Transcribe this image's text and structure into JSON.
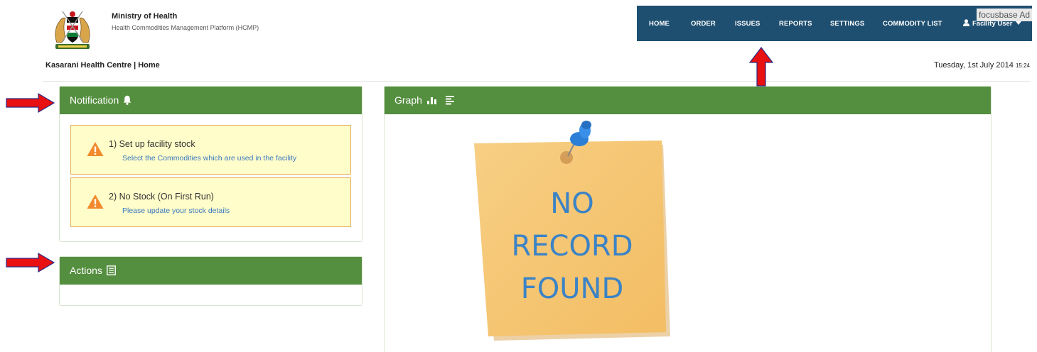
{
  "header": {
    "ministry_title": "Ministry of Health",
    "ministry_subtitle": "Health Commodities Management Platform (HCMP)"
  },
  "nav": {
    "items": [
      {
        "label": "HOME"
      },
      {
        "label": "ORDER"
      },
      {
        "label": "ISSUES"
      },
      {
        "label": "REPORTS"
      },
      {
        "label": "SETTINGS"
      },
      {
        "label": "COMMODITY LIST"
      }
    ],
    "user_label": "Facility User",
    "ad_label": "focusbase Ad"
  },
  "page": {
    "breadcrumb": "Kasarani Health Centre | Home",
    "date": "Tuesday, 1st July 2014",
    "time": "15:24"
  },
  "notification_panel": {
    "title": "Notification",
    "icon": "bell-icon",
    "items": [
      {
        "title": "1) Set up facility stock",
        "link": "Select the Commodities which are used in the facility",
        "icon": "warning-icon"
      },
      {
        "title": "2) No Stock (On First Run)",
        "link": "Please update your stock details",
        "icon": "warning-icon"
      }
    ]
  },
  "actions_panel": {
    "title": "Actions",
    "icon": "list-icon"
  },
  "graph_panel": {
    "title": "Graph",
    "icons": [
      "bar-chart-icon",
      "align-left-icon"
    ],
    "empty_note": {
      "lines": [
        "NO",
        "RECORD",
        "FOUND"
      ]
    }
  },
  "colors": {
    "nav_background": "#1e4f70",
    "panel_header": "#548e3f",
    "notice_background": "#fffdc9",
    "notice_border": "#e2b15f",
    "link": "#3a78c2",
    "annotation_arrow": "#e81010"
  }
}
